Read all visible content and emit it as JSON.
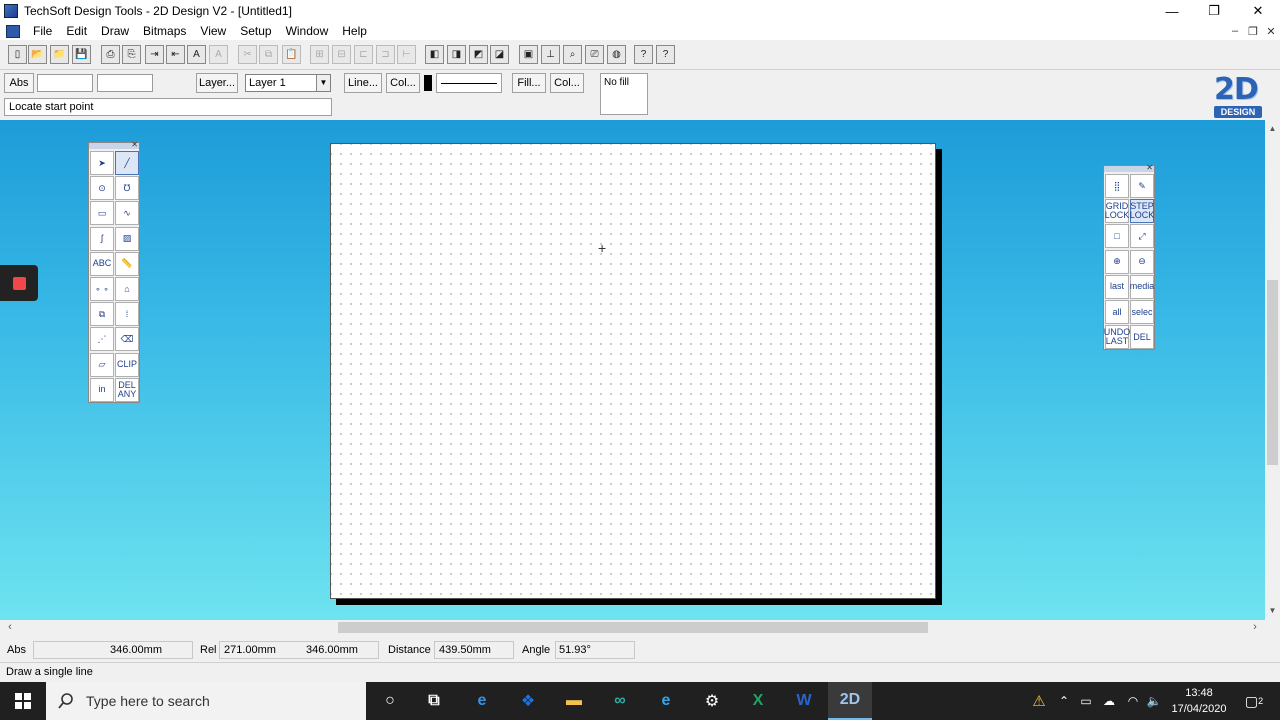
{
  "window": {
    "title": "TechSoft Design Tools - 2D Design V2 - [Untitled1]",
    "controls": {
      "minimize": "—",
      "restore": "❐",
      "close": "✕"
    },
    "mdi_controls": {
      "minimize": "–",
      "restore": "❐",
      "close": "✕"
    }
  },
  "menu": [
    "File",
    "Edit",
    "Draw",
    "Bitmaps",
    "View",
    "Setup",
    "Window",
    "Help"
  ],
  "toolbar": {
    "icons": [
      "new-file-icon",
      "open-file-icon",
      "open-folder-icon",
      "save-icon",
      "print-icon",
      "print-preview-icon",
      "export-icon",
      "import-icon",
      "text-icon",
      "text-style-icon",
      "cut-icon",
      "copy-icon",
      "paste-icon",
      "group-icon",
      "ungroup-icon",
      "align-icon",
      "distribute-icon",
      "spacing-icon",
      "shape-front-icon",
      "shape-back-icon",
      "shape-raise-icon",
      "shape-lower-icon",
      "frame-icon",
      "dimension-icon",
      "zoom-view-icon",
      "plotter-icon",
      "globe-icon",
      "context-help-icon",
      "help-icon"
    ]
  },
  "properties": {
    "coord_mode": "Abs",
    "x_value": "",
    "y_value": "",
    "layer_button": "Layer...",
    "layer_selected": "Layer 1",
    "line_button": "Line...",
    "line_color_button": "Col...",
    "fill_button": "Fill...",
    "fill_color_button": "Col...",
    "fill_preview": "No fill",
    "prompt": "Locate start point"
  },
  "logo": {
    "big": "2D",
    "small": "DESIGN"
  },
  "left_palette": {
    "tools": [
      {
        "name": "select-arrow-tool",
        "icon": "arrow-cursor-icon",
        "label": "➤",
        "active": false
      },
      {
        "name": "line-tool",
        "icon": "line-icon",
        "label": "╱",
        "active": true
      },
      {
        "name": "circle-tool",
        "icon": "circle-icon",
        "label": "⊙",
        "active": false
      },
      {
        "name": "arc-tool",
        "icon": "arc-icon",
        "label": "℧",
        "active": false
      },
      {
        "name": "rectangle-tool",
        "icon": "rectangle-icon",
        "label": "▭",
        "active": false
      },
      {
        "name": "curve-tool",
        "icon": "curve-icon",
        "label": "∿",
        "active": false
      },
      {
        "name": "fillet-tool",
        "icon": "fillet-icon",
        "label": "ʃ",
        "active": false
      },
      {
        "name": "hatch-tool",
        "icon": "hatch-icon",
        "label": "▨",
        "active": false
      },
      {
        "name": "text-tool",
        "icon": "text-abc-icon",
        "label": "ABC",
        "active": false
      },
      {
        "name": "dimension-tool",
        "icon": "ruler-icon",
        "label": "📏",
        "active": false
      },
      {
        "name": "point-tool",
        "icon": "points-icon",
        "label": "∘ ∘",
        "active": false
      },
      {
        "name": "perspective-tool",
        "icon": "perspective-icon",
        "label": "⌂",
        "active": false
      },
      {
        "name": "copy-shape-tool",
        "icon": "copy-shape-icon",
        "label": "⧉",
        "active": false
      },
      {
        "name": "array-tool",
        "icon": "array-icon",
        "label": "⁞",
        "active": false
      },
      {
        "name": "snap-tool",
        "icon": "snap-icon",
        "label": "⋰",
        "active": false
      },
      {
        "name": "eraser-tool",
        "icon": "eraser-icon",
        "label": "⌫",
        "active": false
      },
      {
        "name": "polygon-tool",
        "icon": "polygon-icon",
        "label": "▱",
        "active": false
      },
      {
        "name": "clip-tool",
        "icon": "clip-icon",
        "label": "CLIP",
        "active": false
      },
      {
        "name": "in-tool",
        "icon": "in-icon",
        "label": "in",
        "active": false
      },
      {
        "name": "delete-any-tool",
        "icon": "del-any-icon",
        "label": "DEL ANY",
        "active": false
      }
    ]
  },
  "right_palette": {
    "tools": [
      {
        "name": "grid-tool",
        "icon": "grid-icon",
        "label": "⣿",
        "active": false
      },
      {
        "name": "pen-tool",
        "icon": "pen-icon",
        "label": "✎",
        "active": false
      },
      {
        "name": "grid-lock-tool",
        "icon": "grid-lock-icon",
        "label": "GRID LOCK",
        "active": false
      },
      {
        "name": "step-lock-tool",
        "icon": "step-lock-icon",
        "label": "STEP LOCK",
        "active": true
      },
      {
        "name": "window-zoom-tool",
        "icon": "window-icon",
        "label": "□",
        "active": false
      },
      {
        "name": "scale-tool",
        "icon": "scale-icon",
        "label": "⤢",
        "active": false
      },
      {
        "name": "zoom-in-tool",
        "icon": "zoom-in-icon",
        "label": "⊕",
        "active": false
      },
      {
        "name": "zoom-out-tool",
        "icon": "zoom-out-icon",
        "label": "⊖",
        "active": false
      },
      {
        "name": "last-tool",
        "icon": "last-icon",
        "label": "last",
        "active": false
      },
      {
        "name": "media-tool",
        "icon": "media-icon",
        "label": "media",
        "active": false
      },
      {
        "name": "all-tool",
        "icon": "all-icon",
        "label": "all",
        "active": false
      },
      {
        "name": "select-tool",
        "icon": "select-icon",
        "label": "selec",
        "active": false
      },
      {
        "name": "undo-last-tool",
        "icon": "undo-icon",
        "label": "UNDO LAST",
        "active": false
      },
      {
        "name": "delete-tool",
        "icon": "delete-icon",
        "label": "DEL",
        "active": false
      }
    ]
  },
  "coords": {
    "abs_label": "Abs",
    "abs_x": "",
    "abs_y": "346.00mm",
    "rel_label": "Rel",
    "rel_x": "271.00mm",
    "rel_y": "346.00mm",
    "distance_label": "Distance",
    "distance_value": "439.50mm",
    "angle_label": "Angle",
    "angle_value": "51.93°"
  },
  "status": "Draw a single line",
  "taskbar": {
    "search_placeholder": "Type here to search",
    "apps": [
      {
        "name": "cortana",
        "icon": "circle-icon",
        "label": "○"
      },
      {
        "name": "task-view",
        "icon": "task-view-icon",
        "label": "⧉"
      },
      {
        "name": "edge",
        "icon": "edge-icon",
        "label": "e"
      },
      {
        "name": "dropbox",
        "icon": "dropbox-icon",
        "label": "❖"
      },
      {
        "name": "file-explorer",
        "icon": "folder-icon",
        "label": "▬"
      },
      {
        "name": "arduino",
        "icon": "infinity-icon",
        "label": "∞"
      },
      {
        "name": "internet-explorer",
        "icon": "ie-icon",
        "label": "e"
      },
      {
        "name": "settings",
        "icon": "gear-icon",
        "label": "⚙"
      },
      {
        "name": "excel",
        "icon": "excel-icon",
        "label": "X"
      },
      {
        "name": "word",
        "icon": "word-icon",
        "label": "W"
      },
      {
        "name": "2d-design",
        "icon": "2d-design-icon",
        "label": "2D"
      }
    ],
    "time": "13:48",
    "date": "17/04/2020",
    "notifications": "2"
  },
  "colors": {
    "workspace_top": "#1d9cd8",
    "workspace_bottom": "#6ee3f0",
    "accent": "#2d63b4",
    "taskbar": "#202020"
  }
}
